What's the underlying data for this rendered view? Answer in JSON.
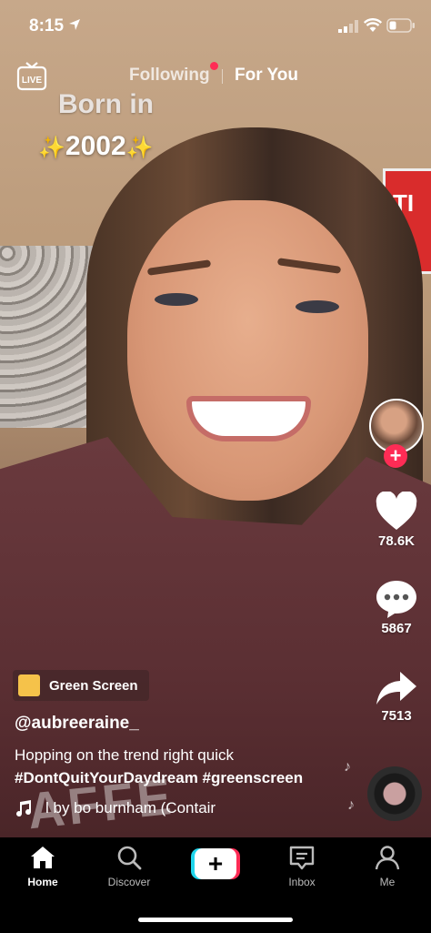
{
  "status_bar": {
    "time": "8:15"
  },
  "top_nav": {
    "live_label": "LIVE",
    "tabs": [
      {
        "label": "Following",
        "active": false
      },
      {
        "label": "For You",
        "active": true
      }
    ]
  },
  "video_overlay": {
    "line1": "Born in",
    "line2_sparkle_left": "✨",
    "line2_text": "2002",
    "line2_sparkle_right": "✨",
    "sign_text": "TI"
  },
  "right_rail": {
    "likes": "78.6K",
    "comments": "5867",
    "shares": "7513"
  },
  "caption": {
    "effect": "Green Screen",
    "username": "@aubreeraine_",
    "text": "Hopping on the trend right quick",
    "hashtags": "#DontQuitYourDaydream #greenscreen",
    "music": "l by bo burnham (Contair"
  },
  "bottom_nav": {
    "items": [
      {
        "label": "Home",
        "icon": "home-icon",
        "active": true
      },
      {
        "label": "Discover",
        "icon": "search-icon",
        "active": false
      },
      {
        "label": "",
        "icon": "create-icon",
        "active": false
      },
      {
        "label": "Inbox",
        "icon": "inbox-icon",
        "active": false
      },
      {
        "label": "Me",
        "icon": "profile-icon",
        "active": false
      }
    ]
  },
  "colors": {
    "accent_red": "#fe2c55",
    "accent_cyan": "#20d5ec",
    "nav_bg": "#000000"
  }
}
